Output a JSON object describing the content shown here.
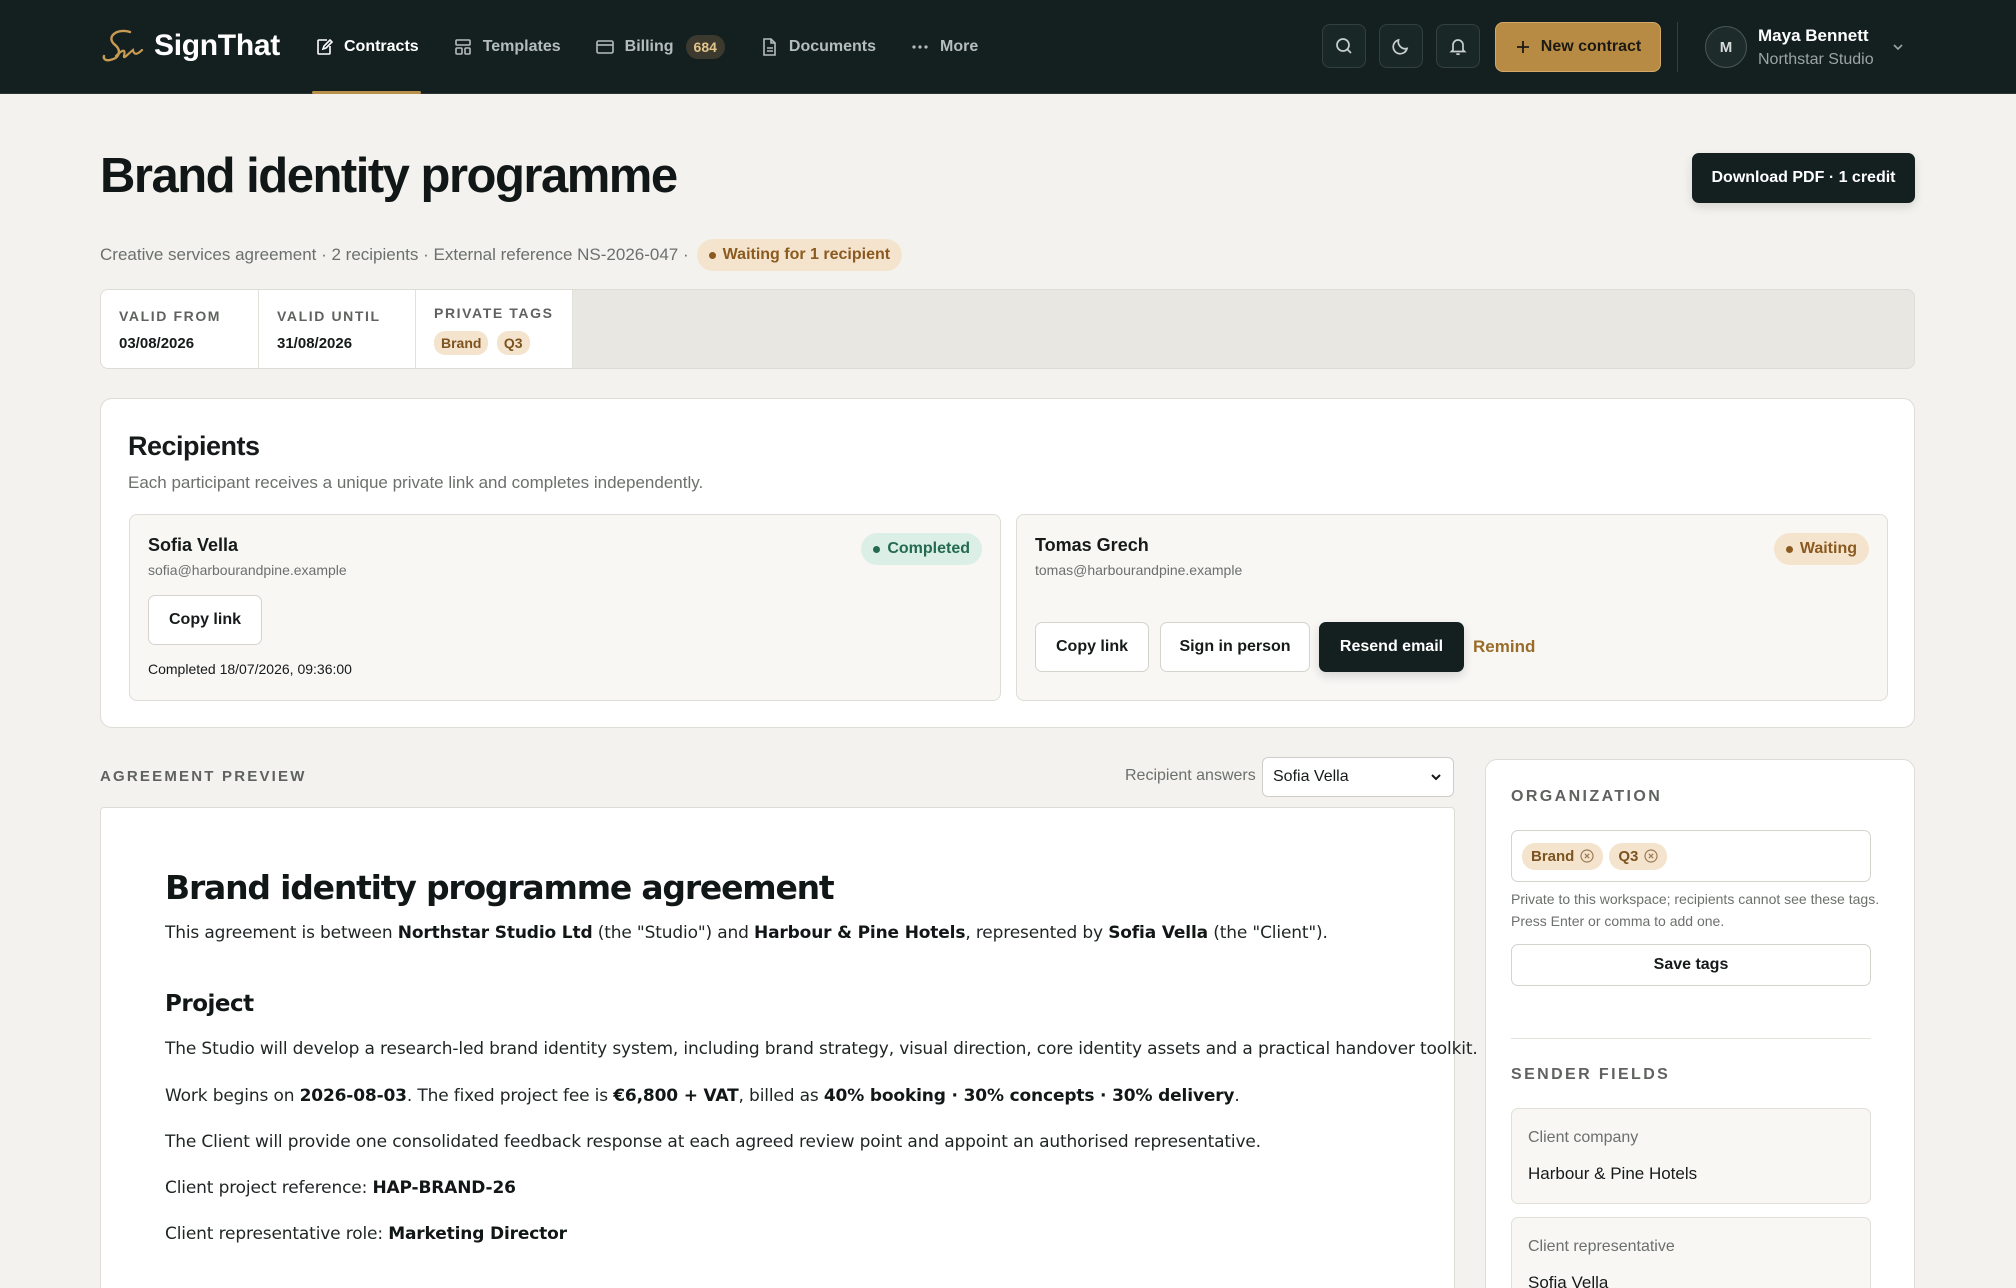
{
  "app": {
    "name": "SignThat",
    "nav": [
      {
        "label": "Contracts",
        "icon": "contract-icon",
        "active": true
      },
      {
        "label": "Templates",
        "icon": "templates-icon"
      },
      {
        "label": "Billing",
        "icon": "billing-icon",
        "badge": "684"
      },
      {
        "label": "Documents",
        "icon": "document-icon"
      },
      {
        "label": "More",
        "icon": "more-icon"
      }
    ],
    "new_contract_label": "New contract",
    "user": {
      "initial": "M",
      "name": "Maya Bennett",
      "org": "Northstar Studio"
    },
    "accent": "#b88b45"
  },
  "header": {
    "title": "Brand identity programme",
    "download_label": "Download PDF · 1 credit",
    "meta": "Creative services agreement · 2 recipients · External reference NS-2026-047 ·",
    "status": "Waiting for 1 recipient"
  },
  "meta_strip": {
    "valid_from_label": "VALID FROM",
    "valid_from": "03/08/2026",
    "valid_until_label": "VALID UNTIL",
    "valid_until": "31/08/2026",
    "tags_label": "PRIVATE TAGS",
    "tags": [
      "Brand",
      "Q3"
    ]
  },
  "recipients": {
    "title": "Recipients",
    "subtitle": "Each participant receives a unique private link and completes independently.",
    "list": [
      {
        "name": "Sofia Vella",
        "email": "sofia@harbourandpine.example",
        "status": "Completed",
        "copy_label": "Copy link",
        "completed_text": "Completed 18/07/2026, 09:36:00"
      },
      {
        "name": "Tomas Grech",
        "email": "tomas@harbourandpine.example",
        "status": "Waiting",
        "copy_label": "Copy link",
        "sign_label": "Sign in person",
        "resend_label": "Resend email",
        "remind_label": "Remind"
      }
    ]
  },
  "preview": {
    "section_label": "AGREEMENT PREVIEW",
    "answers_label": "Recipient answers",
    "answers_selected": "Sofia Vella",
    "doc": {
      "title": "Brand identity programme agreement",
      "intro_1": "This agreement is between ",
      "studio": "Northstar Studio Ltd",
      "intro_2": " (the \"Studio\") and ",
      "client": "Harbour & Pine Hotels",
      "intro_3": ", represented by ",
      "rep": "Sofia Vella",
      "intro_4": " (the \"Client\").",
      "project_heading": "Project",
      "p1": "The Studio will develop a research-led brand identity system, including brand strategy, visual direction, core identity assets and a practical handover toolkit.",
      "p2_a": "Work begins on ",
      "start_date": "2026-08-03",
      "p2_b": ". The fixed project fee is ",
      "fee": "€6,800 + VAT",
      "p2_c": ", billed as ",
      "billing": "40% booking · 30% concepts · 30% delivery",
      "p2_d": ".",
      "p3": "The Client will provide one consolidated feedback response at each agreed review point and appoint an authorised representative.",
      "p4_label": "Client project reference: ",
      "p4_value": "HAP-BRAND-26",
      "p5_label": "Client representative role: ",
      "p5_value": "Marketing Director"
    }
  },
  "side": {
    "org_label": "ORGANIZATION",
    "tags": [
      "Brand",
      "Q3"
    ],
    "help": "Private to this workspace; recipients cannot see these tags. Press Enter or comma to add one.",
    "save_label": "Save tags",
    "sender_label": "SENDER FIELDS",
    "fields": [
      {
        "label": "Client company",
        "value": "Harbour & Pine Hotels"
      },
      {
        "label": "Client representative",
        "value": "Sofia Vella"
      }
    ]
  }
}
